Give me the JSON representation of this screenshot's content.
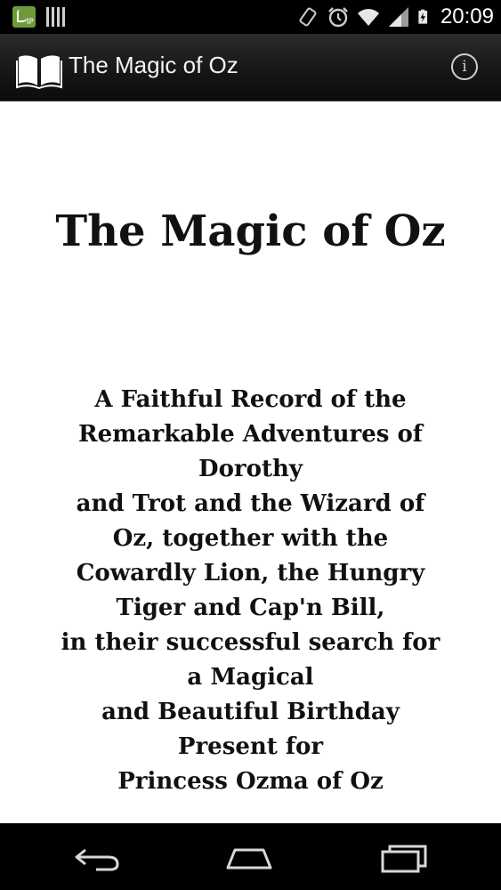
{
  "status_bar": {
    "time": "20:09",
    "icons": [
      "call-notification-icon",
      "barcode-notification-icon",
      "vibrate-icon",
      "alarm-icon",
      "wifi-icon",
      "signal-icon",
      "battery-charging-icon"
    ]
  },
  "action_bar": {
    "app_icon": "open-book-icon",
    "title": "The Magic of Oz",
    "info_icon": "info-icon",
    "info_glyph": "i"
  },
  "content": {
    "title": "The Magic of Oz",
    "subtitle_lines": [
      "A Faithful Record of the",
      "Remarkable Adventures of",
      "Dorothy",
      "and Trot and the Wizard of",
      "Oz, together with the",
      "Cowardly Lion, the Hungry",
      "Tiger and Cap'n Bill,",
      "in their successful search for",
      "a Magical",
      "and Beautiful Birthday",
      "Present for",
      "Princess Ozma of Oz"
    ]
  },
  "nav_bar": {
    "buttons": [
      "back-icon",
      "home-icon",
      "recent-apps-icon"
    ]
  },
  "colors": {
    "status_bar_bg": "#000000",
    "action_bar_bg": "#151515",
    "content_bg": "#ffffff",
    "nav_bar_bg": "#000000",
    "notification_green": "#6f9a3a"
  }
}
